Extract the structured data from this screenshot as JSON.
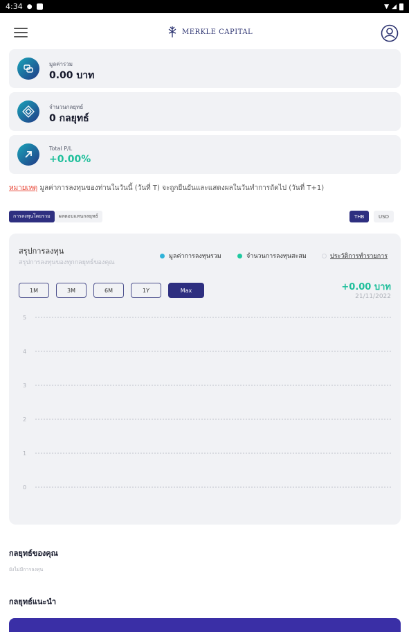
{
  "status_bar": {
    "time": "4:34"
  },
  "header": {
    "logo_text": "MERKLE CAPITAL"
  },
  "summary_cards": [
    {
      "label": "มูลค่ารวม",
      "value": "0.00 บาท",
      "icon": "wallet-icon"
    },
    {
      "label": "จำนวนกลยุทธ์",
      "value": "0 กลยุทธ์",
      "icon": "strategy-grid-icon"
    },
    {
      "label": "Total P/L",
      "value": "+0.00%",
      "icon": "trend-up-arrow-icon"
    }
  ],
  "notice": {
    "prefix": "หมายเหตุ",
    "text": " มูลค่าการลงทุนของท่านในวันนี้ (วันที่ T) จะถูกยืนยันและแสดงผลในวันทำการถัดไป (วันที่ T+1)"
  },
  "view_tabs": [
    {
      "label": "การลงทุนโดยรวม",
      "active": true
    },
    {
      "label": "ผลตอบแทนกลยุทธ์",
      "active": false
    }
  ],
  "currency_toggle": [
    {
      "label": "THB",
      "active": true
    },
    {
      "label": "USD",
      "active": false
    }
  ],
  "chart_card": {
    "title": "สรุปการลงทุน",
    "subtitle": "สรุปการลงทุนของทุกกลยุทธ์ของคุณ",
    "legend": [
      {
        "label": "มูลค่าการลงทุนรวม",
        "color": "#2fb3d9"
      },
      {
        "label": "จำนวนการลงทุนสะสม",
        "color": "#1fc9a0"
      }
    ],
    "history_link": "ประวัติการทำรายการ",
    "ranges": [
      {
        "label": "1M",
        "active": false
      },
      {
        "label": "3M",
        "active": false
      },
      {
        "label": "6M",
        "active": false
      },
      {
        "label": "1Y",
        "active": false
      },
      {
        "label": "Max",
        "active": true
      }
    ],
    "pl_value": "+0.00 บาท",
    "pl_date": "21/11/2022"
  },
  "chart_data": {
    "type": "line",
    "series": [],
    "y_ticks": [
      "5",
      "4",
      "3",
      "2",
      "1",
      "0"
    ],
    "ylim": [
      0,
      5
    ],
    "grid": true,
    "title": "",
    "xlabel": "",
    "ylabel": ""
  },
  "my_strategies": {
    "title": "กลยุทธ์ของคุณ",
    "subtitle": "ยังไม่มีการลงทุน"
  },
  "recommended": {
    "title": "กลยุทธ์แนะนำ"
  },
  "colors": {
    "primary": "#2e2f80",
    "positive": "#1fbf9b",
    "warning": "#e84a3b"
  }
}
